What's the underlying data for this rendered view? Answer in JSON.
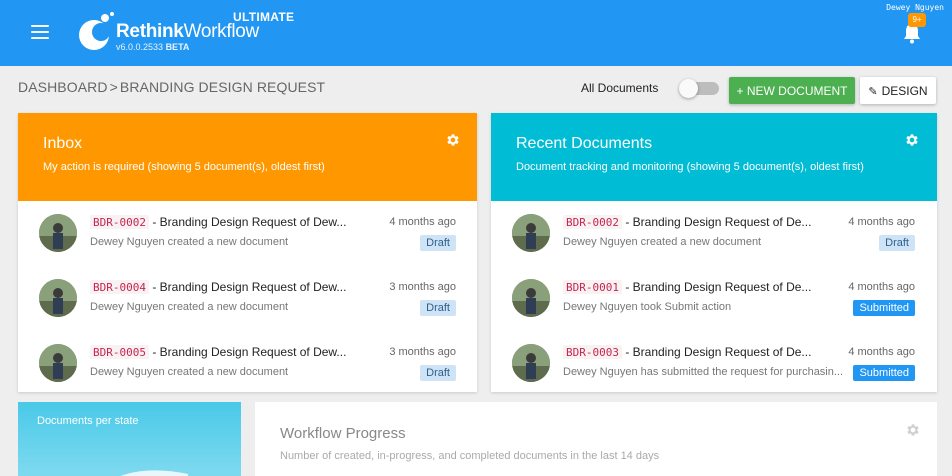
{
  "header": {
    "brand_bold": "Rethink",
    "brand_regular": "Workflow",
    "edition": "ULTIMATE",
    "version": "v6.0.0.2533",
    "version_tag": "BETA",
    "username": "Dewey Nguyen",
    "notifications_badge": "9+",
    "icons": [
      "menu-icon",
      "logo-icon",
      "bell-icon"
    ],
    "color": "#2196f3"
  },
  "toolbar": {
    "breadcrumb_root": "DASHBOARD",
    "breadcrumb_sep": ">",
    "breadcrumb_current": "BRANDING DESIGN REQUEST",
    "all_documents_label": "All Documents",
    "all_documents_on": false,
    "new_document_label": "+ NEW DOCUMENT",
    "design_label": "DESIGN"
  },
  "inbox": {
    "title": "Inbox",
    "subtitle": "My action is required (showing 5 document(s), oldest first)",
    "color": "#ff9800",
    "items": [
      {
        "code": "BDR-0002",
        "title": " - Branding Design Request of Dew...",
        "sub": "Dewey Nguyen created a new document",
        "time": "4 months ago",
        "status": "Draft"
      },
      {
        "code": "BDR-0004",
        "title": " - Branding Design Request of Dew...",
        "sub": "Dewey Nguyen created a new document",
        "time": "3 months ago",
        "status": "Draft"
      },
      {
        "code": "BDR-0005",
        "title": " - Branding Design Request of Dew...",
        "sub": "Dewey Nguyen created a new document",
        "time": "3 months ago",
        "status": "Draft"
      }
    ]
  },
  "recent": {
    "title": "Recent Documents",
    "subtitle": "Document tracking and monitoring (showing 5 document(s), oldest first)",
    "color": "#00bcd4",
    "items": [
      {
        "code": "BDR-0002",
        "title": " - Branding Design Request of De...",
        "sub": "Dewey Nguyen created a new document",
        "time": "4 months ago",
        "status": "Draft"
      },
      {
        "code": "BDR-0001",
        "title": " - Branding Design Request of De...",
        "sub": "Dewey Nguyen took Submit action",
        "time": "4 months ago",
        "status": "Submitted"
      },
      {
        "code": "BDR-0003",
        "title": " - Branding Design Request of De...",
        "sub": "Dewey Nguyen has submitted the request for purchasin...",
        "time": "4 months ago",
        "status": "Submitted"
      }
    ]
  },
  "documents_per_state": {
    "title": "Documents per state"
  },
  "workflow_progress": {
    "title": "Workflow Progress",
    "subtitle": "Number of created, in-progress, and completed documents in the last 14 days"
  }
}
